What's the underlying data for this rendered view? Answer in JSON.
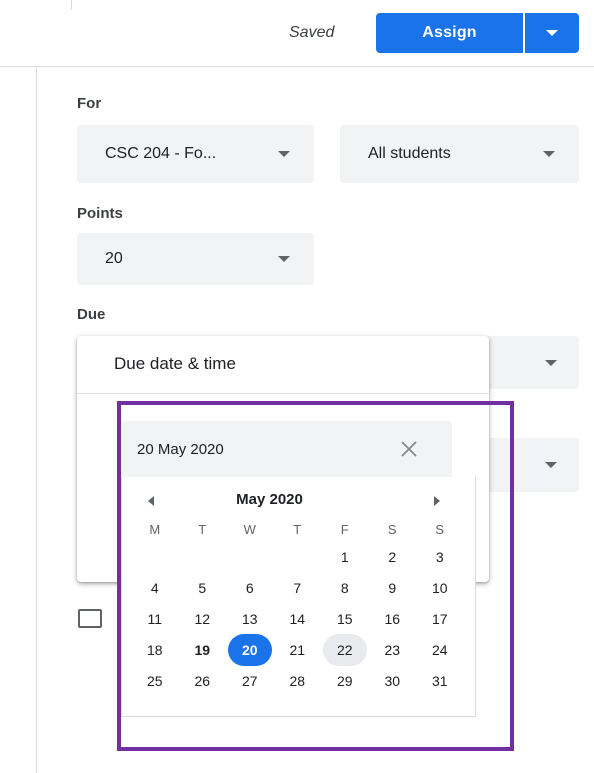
{
  "header": {
    "saved_text": "Saved",
    "assign_label": "Assign",
    "assign_menu_icon": "caret-down-icon"
  },
  "form": {
    "for_label": "For",
    "class_value": "CSC 204 - Fo...",
    "students_value": "All students",
    "points_label": "Points",
    "points_value": "20",
    "due_label": "Due"
  },
  "due_popup": {
    "title": "Due date & time",
    "date_value": "20 May 2020",
    "clear_icon": "close-icon"
  },
  "calendar": {
    "month_label": "May 2020",
    "weekdays": [
      "M",
      "T",
      "W",
      "T",
      "F",
      "S",
      "S"
    ],
    "leading_blanks": 4,
    "days": [
      "1",
      "2",
      "3",
      "4",
      "5",
      "6",
      "7",
      "8",
      "9",
      "10",
      "11",
      "12",
      "13",
      "14",
      "15",
      "16",
      "17",
      "18",
      "19",
      "20",
      "21",
      "22",
      "23",
      "24",
      "25",
      "26",
      "27",
      "28",
      "29",
      "30",
      "31"
    ],
    "today": "19",
    "selected": "20",
    "hovered": "22"
  },
  "colors": {
    "accent": "#1a73e8",
    "highlight_box": "#7030a0",
    "field_bg": "#f1f3f4"
  }
}
